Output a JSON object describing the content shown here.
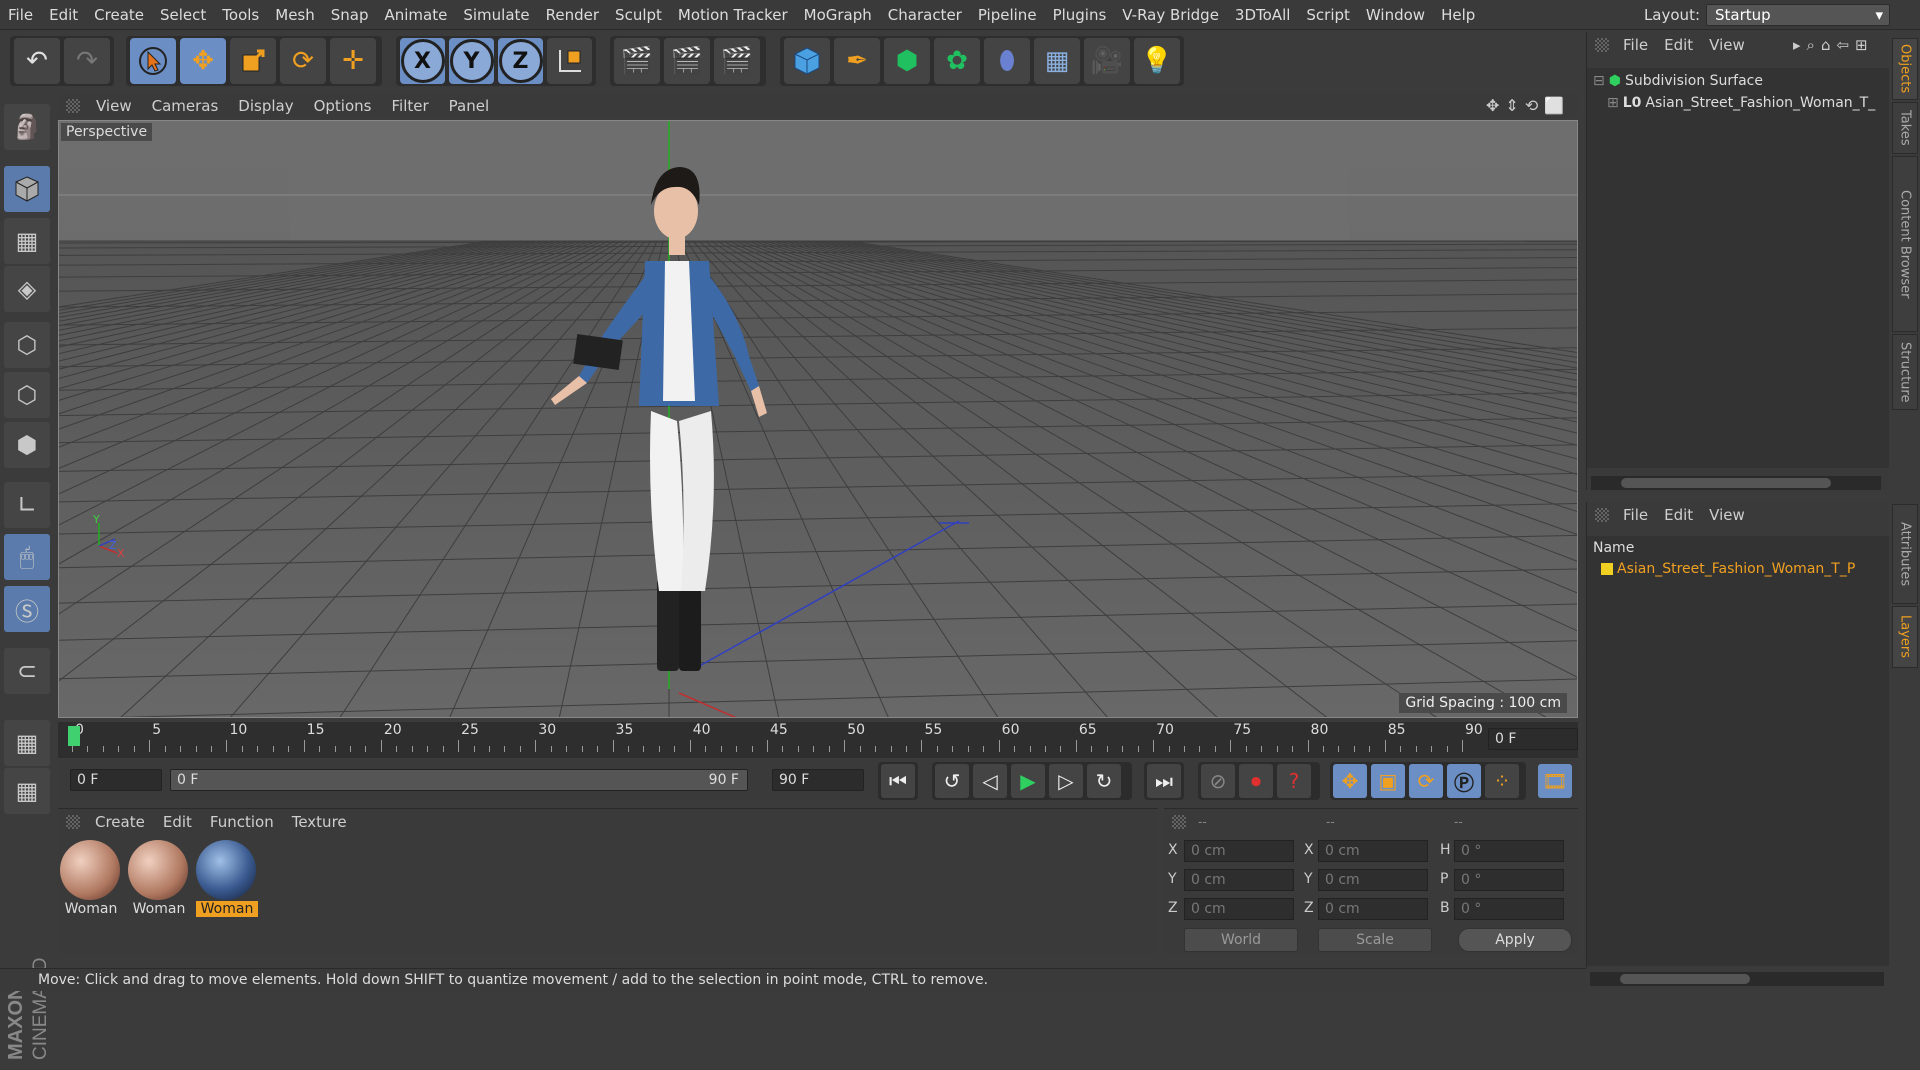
{
  "menu": [
    "File",
    "Edit",
    "Create",
    "Select",
    "Tools",
    "Mesh",
    "Snap",
    "Animate",
    "Simulate",
    "Render",
    "Sculpt",
    "Motion Tracker",
    "MoGraph",
    "Character",
    "Pipeline",
    "Plugins",
    "V-Ray Bridge",
    "3DToAll",
    "Script",
    "Window",
    "Help"
  ],
  "layout": {
    "label": "Layout:",
    "value": "Startup"
  },
  "viewport": {
    "menu": [
      "View",
      "Cameras",
      "Display",
      "Options",
      "Filter",
      "Panel"
    ],
    "camera_label": "Perspective",
    "grid_spacing": "Grid Spacing : 100 cm",
    "axis_y": "Y",
    "axis_z": "Z",
    "axis_x": "X"
  },
  "timeline": {
    "ticks": [
      "0",
      "5",
      "10",
      "15",
      "20",
      "25",
      "30",
      "35",
      "40",
      "45",
      "50",
      "55",
      "60",
      "65",
      "70",
      "75",
      "80",
      "85",
      "90"
    ],
    "current_frame": "0 F",
    "start_frame": "0 F",
    "range_start": "0 F",
    "range_end": "90 F",
    "end_frame": "90 F"
  },
  "materials": {
    "menu": [
      "Create",
      "Edit",
      "Function",
      "Texture"
    ],
    "items": [
      {
        "label": "Woman",
        "selected": false
      },
      {
        "label": "Woman",
        "selected": false
      },
      {
        "label": "Woman",
        "selected": true
      }
    ]
  },
  "coordinates": {
    "header": [
      "--",
      "--",
      "--"
    ],
    "rows": [
      {
        "l1": "X",
        "v1": "0 cm",
        "l2": "X",
        "v2": "0 cm",
        "l3": "H",
        "v3": "0 °"
      },
      {
        "l1": "Y",
        "v1": "0 cm",
        "l2": "Y",
        "v2": "0 cm",
        "l3": "P",
        "v3": "0 °"
      },
      {
        "l1": "Z",
        "v1": "0 cm",
        "l2": "Z",
        "v2": "0 cm",
        "l3": "B",
        "v3": "0 °"
      }
    ],
    "mode1": "World",
    "mode2": "Scale",
    "apply": "Apply"
  },
  "status": "Move: Click and drag to move elements. Hold down SHIFT to quantize movement / add to the selection in point mode, CTRL to remove.",
  "objects": {
    "menu": [
      "File",
      "Edit",
      "View"
    ],
    "items": [
      "Subdivision Surface",
      "Asian_Street_Fashion_Woman_T_"
    ]
  },
  "layers": {
    "menu": [
      "File",
      "Edit",
      "View"
    ],
    "column": "Name",
    "items": [
      "Asian_Street_Fashion_Woman_T_P"
    ]
  },
  "side_tabs": [
    "Objects",
    "Takes",
    "Content Browser",
    "Structure",
    "Attributes",
    "Layers"
  ],
  "logo": {
    "brand": "MAXON",
    "product": "CINEMA 4D"
  },
  "colors": {
    "accent": "#f0a020",
    "active_blue": "#6b8fc4",
    "layer_yellow": "#f0d020"
  }
}
